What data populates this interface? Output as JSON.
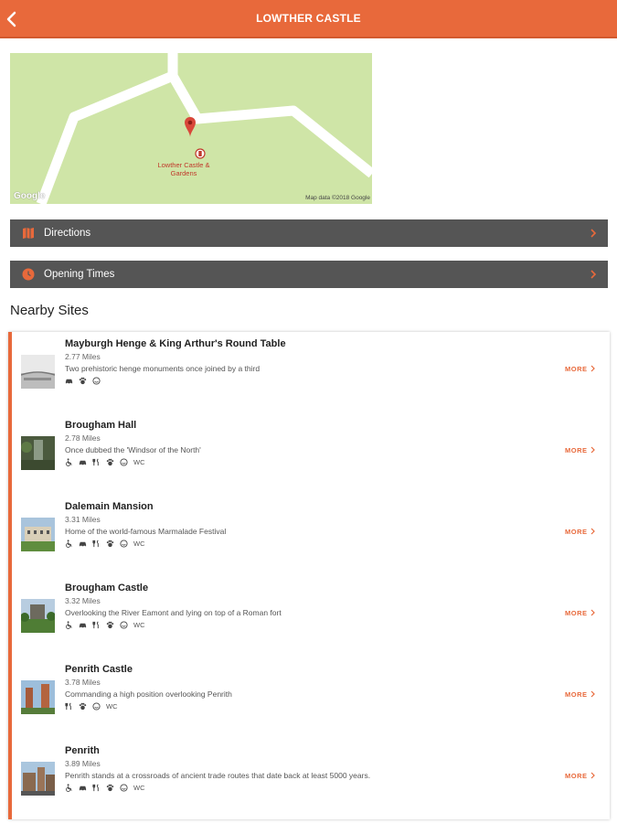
{
  "header": {
    "title": "LOWTHER CASTLE"
  },
  "map": {
    "place_label": "Lowther Castle & Gardens",
    "google_label": "Google",
    "credit": "Map data ©2018 Google"
  },
  "actions": [
    {
      "label": "Directions",
      "icon": "map-icon"
    },
    {
      "label": "Opening Times",
      "icon": "clock-icon"
    }
  ],
  "nearby": {
    "title": "Nearby Sites",
    "more_label": "MORE",
    "sites": [
      {
        "name": "Mayburgh Henge & King Arthur's Round Table",
        "distance": "2.77 Miles",
        "description": "Two prehistoric henge monuments once joined by a third",
        "amenities": [
          "car-icon",
          "dog-icon",
          "smile-icon"
        ]
      },
      {
        "name": "Brougham Hall",
        "distance": "2.78 Miles",
        "description": "Once dubbed the 'Windsor of the North'",
        "amenities": [
          "wheelchair-icon",
          "car-icon",
          "food-icon",
          "dog-icon",
          "smile-icon",
          "WC"
        ]
      },
      {
        "name": "Dalemain Mansion",
        "distance": "3.31 Miles",
        "description": "Home of the world-famous Marmalade Festival",
        "amenities": [
          "wheelchair-icon",
          "car-icon",
          "food-icon",
          "dog-icon",
          "smile-icon",
          "WC"
        ]
      },
      {
        "name": "Brougham Castle",
        "distance": "3.32 Miles",
        "description": "Overlooking the River Eamont and lying on top of a Roman fort",
        "amenities": [
          "wheelchair-icon",
          "car-icon",
          "food-icon",
          "dog-icon",
          "smile-icon",
          "WC"
        ]
      },
      {
        "name": "Penrith Castle",
        "distance": "3.78 Miles",
        "description": "Commanding a high position overlooking Penrith",
        "amenities": [
          "food-icon",
          "dog-icon",
          "smile-icon",
          "WC"
        ]
      },
      {
        "name": "Penrith",
        "distance": "3.89 Miles",
        "description": "Penrith stands at a crossroads of ancient trade routes that date back at least 5000 years.",
        "amenities": [
          "wheelchair-icon",
          "car-icon",
          "food-icon",
          "dog-icon",
          "smile-icon",
          "WC"
        ]
      }
    ]
  },
  "colors": {
    "accent": "#E8693B",
    "bar": "#555555",
    "map_bg": "#CFE5A7"
  }
}
